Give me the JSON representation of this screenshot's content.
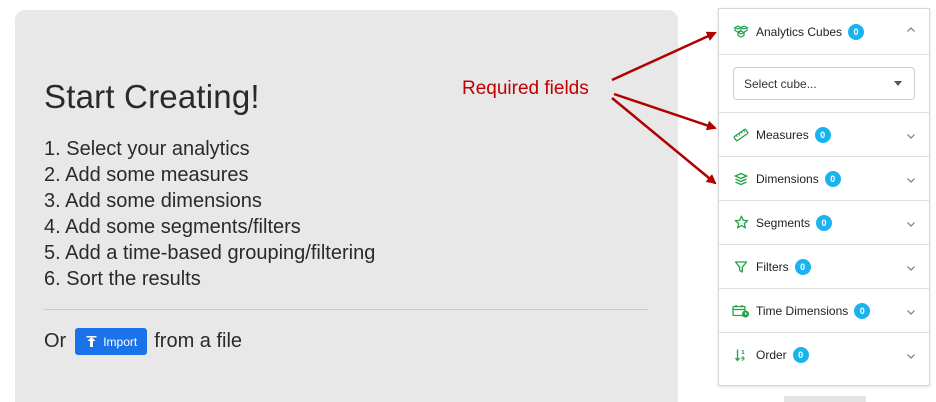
{
  "main": {
    "title": "Start Creating!",
    "steps": [
      "1. Select your analytics",
      "2. Add some measures",
      "3. Add some dimensions",
      "4. Add some segments/filters",
      "5. Add a time-based grouping/filtering",
      "6. Sort the results"
    ],
    "import_prefix": "Or",
    "import_button": "Import",
    "import_suffix": "from a file"
  },
  "annotation": {
    "label": "Required fields",
    "color": "#c00000"
  },
  "panel": {
    "cubes": {
      "label": "Analytics Cubes",
      "count": "0",
      "icon": "cubes-icon",
      "expanded": true
    },
    "cube_select": {
      "value": "Select cube..."
    },
    "sections": [
      {
        "key": "measures",
        "label": "Measures",
        "count": "0",
        "icon": "ruler-icon"
      },
      {
        "key": "dimensions",
        "label": "Dimensions",
        "count": "0",
        "icon": "layers-icon"
      },
      {
        "key": "segments",
        "label": "Segments",
        "count": "0",
        "icon": "star-icon"
      },
      {
        "key": "filters",
        "label": "Filters",
        "count": "0",
        "icon": "filter-icon"
      },
      {
        "key": "time-dimensions",
        "label": "Time Dimensions",
        "count": "0",
        "icon": "calendar-clock-icon"
      },
      {
        "key": "order",
        "label": "Order",
        "count": "0",
        "icon": "sort-icon"
      }
    ]
  },
  "colors": {
    "accent_blue": "#1a73e8",
    "badge_blue": "#1ab3f0",
    "icon_green": "#22a447",
    "card_gray": "#e8e8e8"
  }
}
